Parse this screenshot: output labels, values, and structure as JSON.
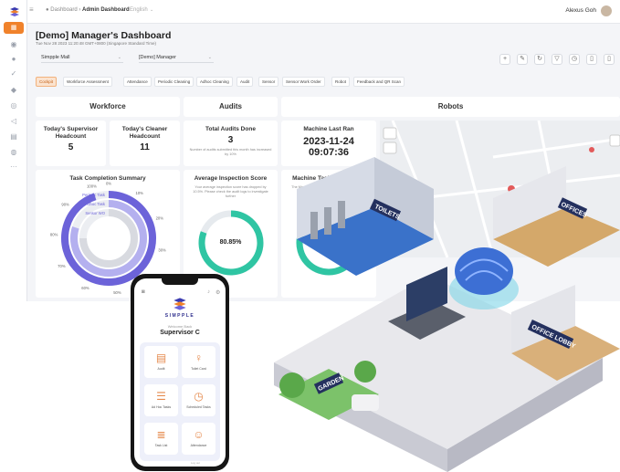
{
  "header": {
    "breadcrumb_root": "Dashboard",
    "breadcrumb_current": "Admin Dashboard",
    "language": "English",
    "user_name": "Alexus Goh"
  },
  "page": {
    "title": "[Demo] Manager's Dashboard",
    "subtitle": "Tue Nov 28 2023 11:20:48 GMT+0800 (Singapore Standard Time)"
  },
  "filters": {
    "site": "Simpple Mall",
    "role": "[Demo] Manager"
  },
  "tabs": [
    "Cockpit",
    "Workforce Assessment",
    "Attendance",
    "Periodic Cleaning",
    "Adhoc Cleaning",
    "Audit",
    "Sensor",
    "Sensor Work Order",
    "Robot",
    "Feedback and QR Scan"
  ],
  "sections": {
    "workforce": "Workforce",
    "audits": "Audits",
    "robots": "Robots"
  },
  "cards": {
    "supervisor": {
      "title": "Today's Supervisor Headcount",
      "value": "5"
    },
    "cleaner": {
      "title": "Today's Cleaner Headcount",
      "value": "11"
    },
    "audits_done": {
      "title": "Total Audits Done",
      "value": "3",
      "subtext": "Number of audits submitted this month has increased by 10%"
    },
    "machine_last_ran": {
      "title": "Machine Last Ran",
      "date": "2023-11-24",
      "time": "09:07:36"
    },
    "task_completion": {
      "title": "Task Completion Summary"
    },
    "inspection": {
      "title": "Average Inspection Score",
      "subtext": "Your average inspection score has dropped by 10.5%. Please check the audit logs to investigate further",
      "value": "80.85%"
    },
    "machine_task": {
      "title": "Machine Task Completion",
      "subtext": "The Machine average task completion score has increased by 0.8%. Keep it up!"
    }
  },
  "chart_data": {
    "type": "bar",
    "title": "Task Completion Summary",
    "categories": [
      "Periodic Task",
      "Adhoc Task",
      "Sensor WO"
    ],
    "values": [
      95,
      80,
      75
    ],
    "tick_labels": [
      "0%",
      "10%",
      "20%",
      "30%",
      "40%",
      "50%",
      "60%",
      "70%",
      "80%",
      "90%",
      "100%"
    ],
    "colors": [
      "#6c63d9",
      "#b4b0ef",
      "#d8dae0"
    ]
  },
  "gauges": {
    "inspection_score": 80.85,
    "machine_task_score": 85
  },
  "map": {
    "labels": [
      "TOILETS",
      "OFFICES",
      "OFFICE LOBBY",
      "GARDEN"
    ]
  },
  "phone": {
    "brand": "SIMPPLE",
    "welcome": "Welcome Back",
    "name": "Supervisor C",
    "tiles": [
      "Audit",
      "Toilet Card",
      "Ad Hoc Tasks",
      "Scheduled Tasks",
      "Task List",
      "Attendance"
    ],
    "footer": "Log out"
  },
  "colors": {
    "accent": "#f0822b",
    "gauge": "#2fc5a3",
    "purple": "#6c63d9"
  }
}
